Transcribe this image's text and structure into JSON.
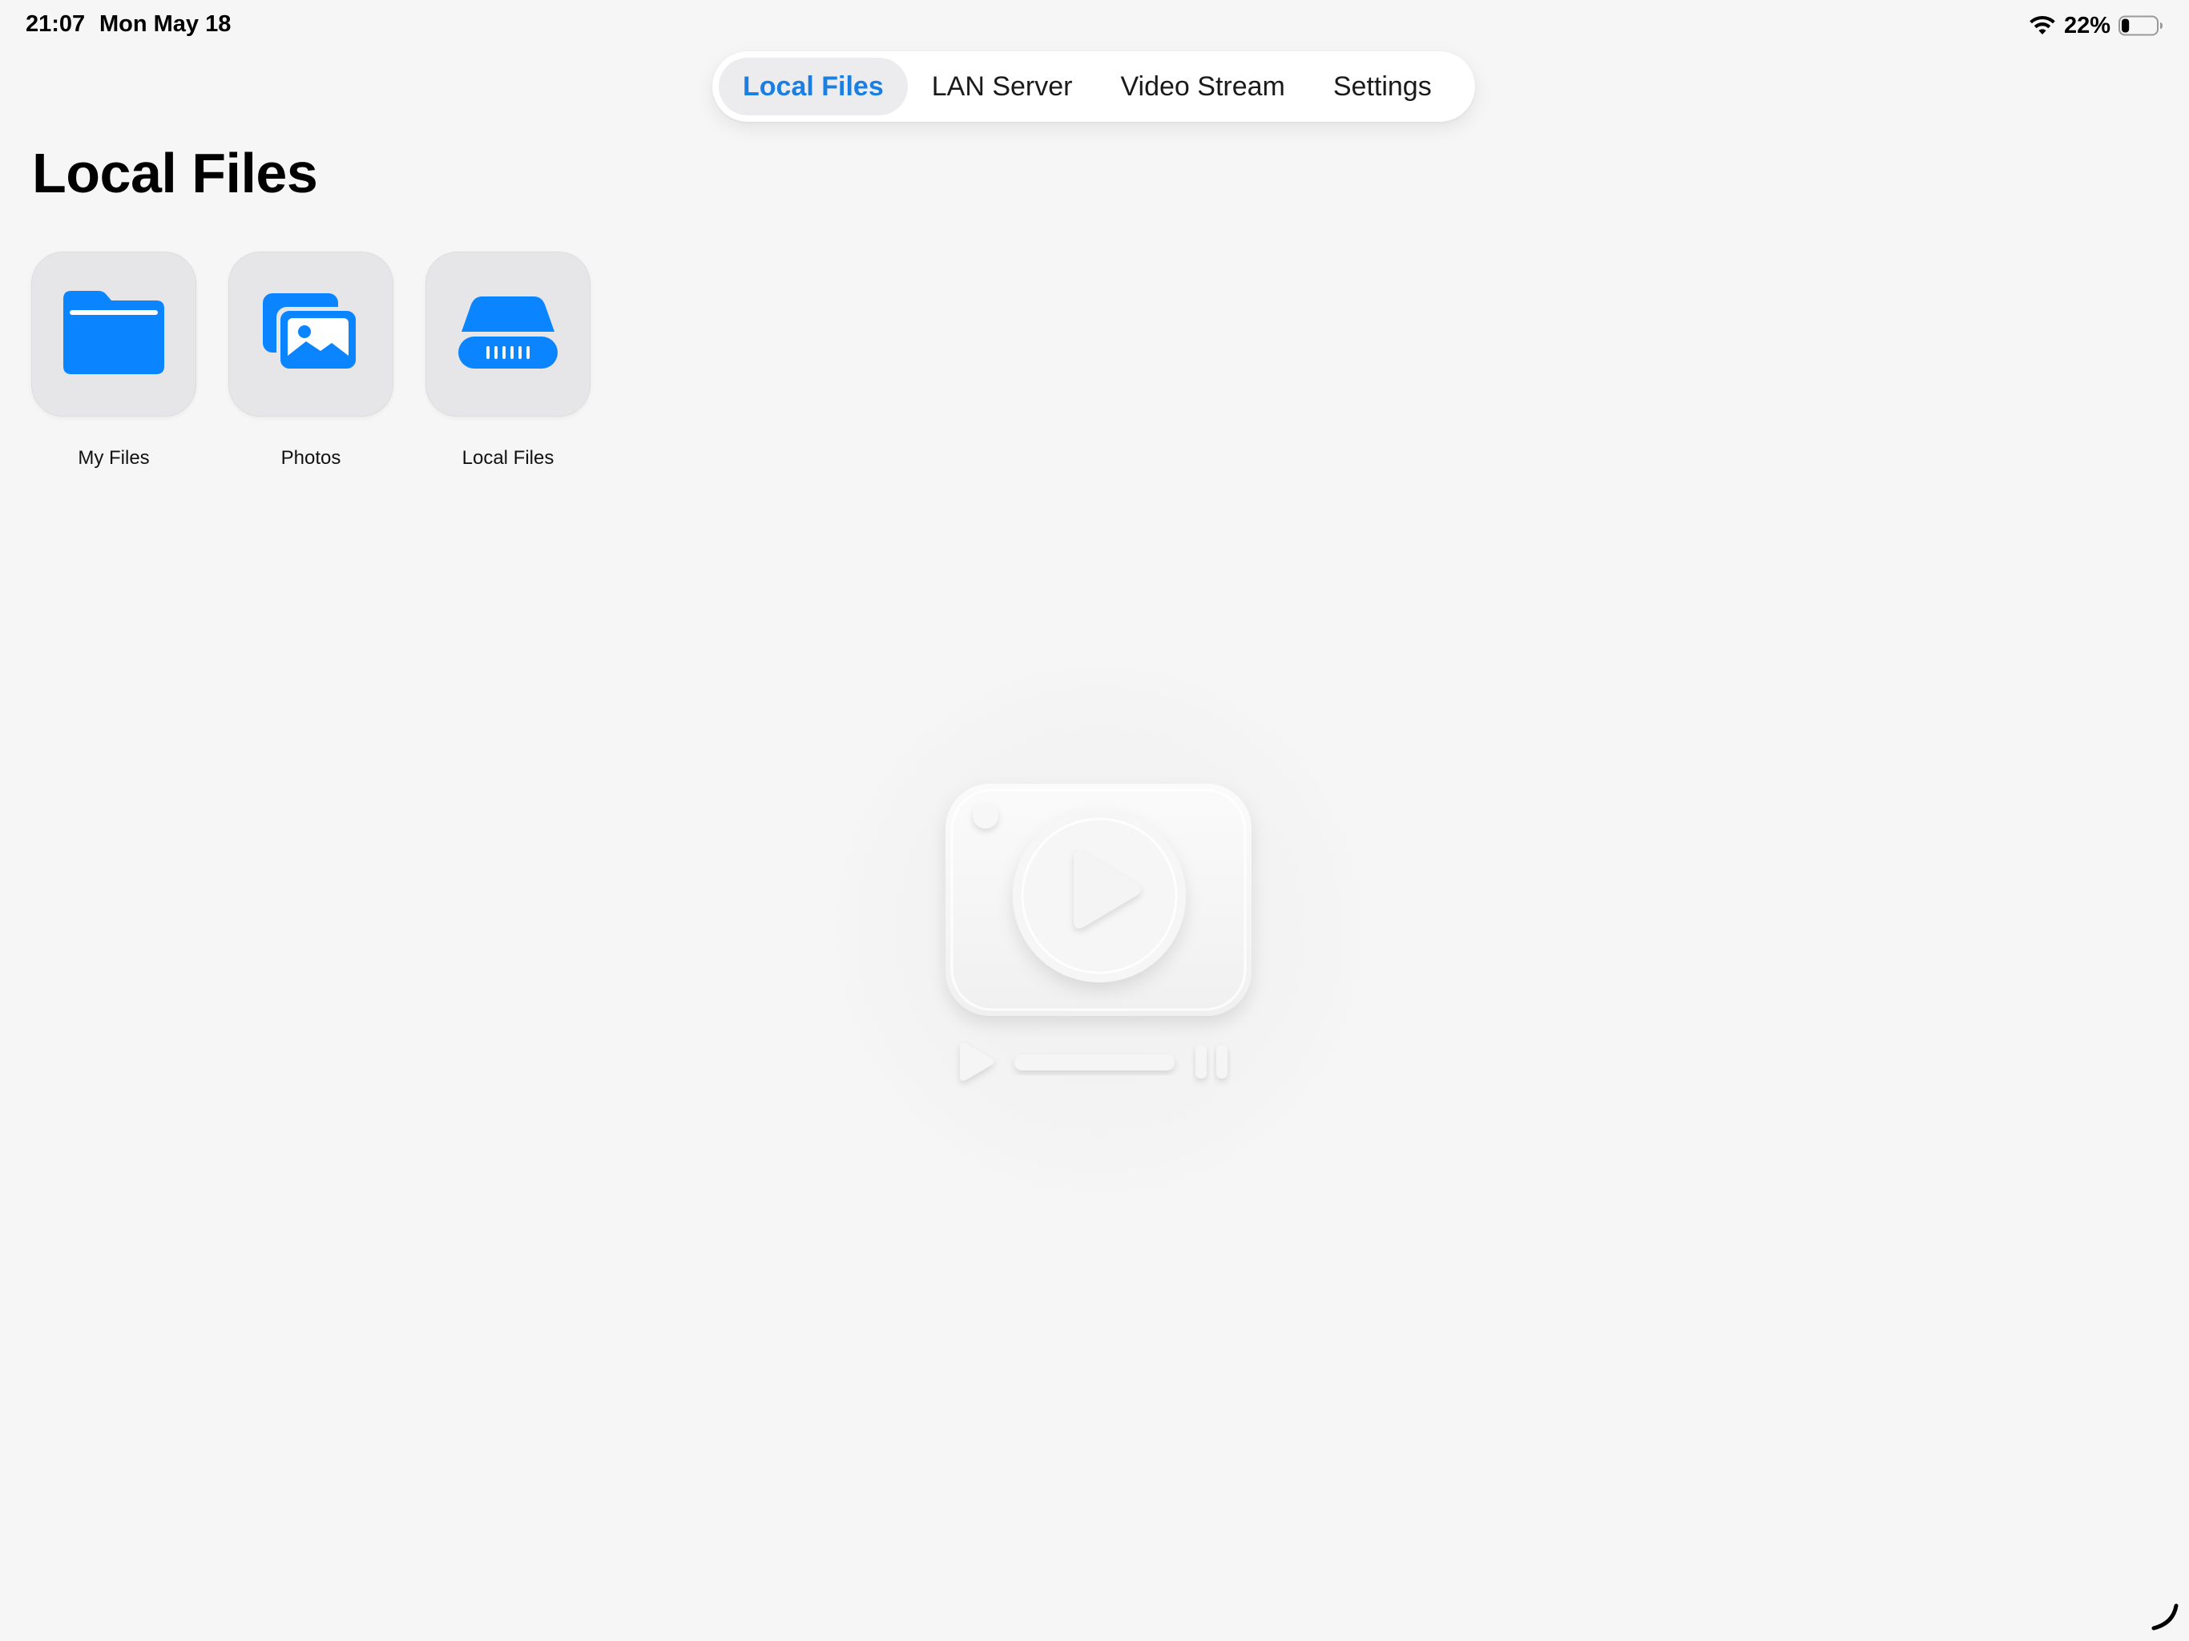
{
  "status_bar": {
    "time": "21:07",
    "date": "Mon May 18",
    "battery_percent": "22%",
    "battery_level": 0.22,
    "wifi_icon": "wifi-icon",
    "battery_icon": "battery-icon"
  },
  "tabs": [
    {
      "label": "Local Files",
      "active": true
    },
    {
      "label": "LAN Server",
      "active": false
    },
    {
      "label": "Video Stream",
      "active": false
    },
    {
      "label": "Settings",
      "active": false
    }
  ],
  "page": {
    "title": "Local Files"
  },
  "tiles": [
    {
      "label": "My Files",
      "icon": "folder-icon"
    },
    {
      "label": "Photos",
      "icon": "photos-icon"
    },
    {
      "label": "Local Files",
      "icon": "drive-icon"
    }
  ],
  "colors": {
    "accent": "#0a84ff",
    "active_tab_text": "#1a7fe0",
    "background": "#f6f6f6",
    "tile_background": "#e6e6e8"
  },
  "illustration": {
    "icon": "video-player-icon"
  }
}
